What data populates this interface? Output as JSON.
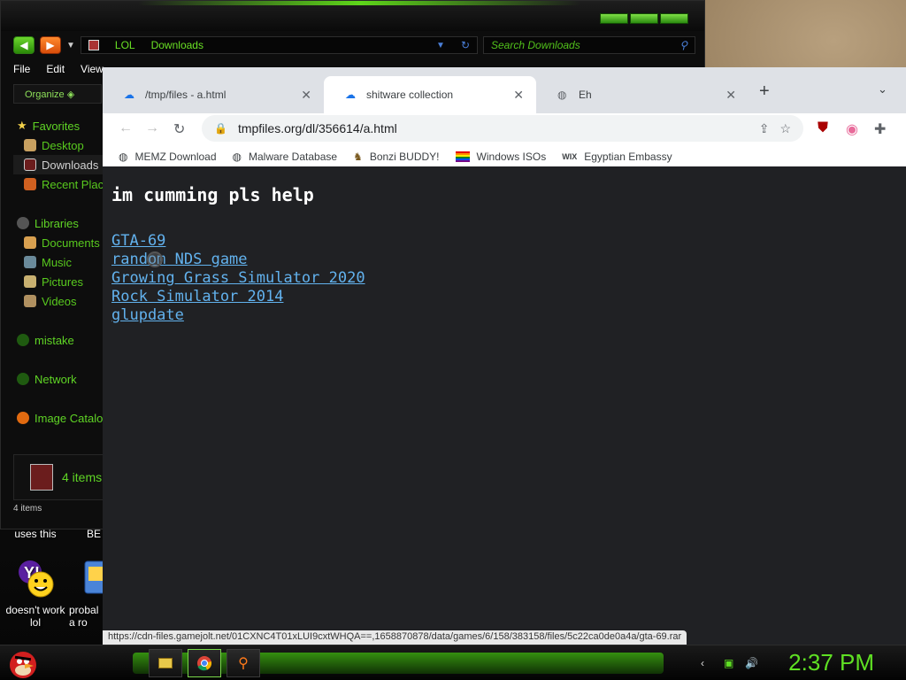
{
  "desktop": {
    "icons": [
      {
        "label": "uses this"
      },
      {
        "label": "BE"
      },
      {
        "label": "doesn't work lol"
      },
      {
        "label": "probal a ro"
      }
    ]
  },
  "explorer": {
    "address_parts": [
      "LOL",
      "Downloads"
    ],
    "search_placeholder": "Search Downloads",
    "menu": [
      "File",
      "Edit",
      "View"
    ],
    "organize_label": "Organize",
    "nav": {
      "favorites": "Favorites",
      "desktop": "Desktop",
      "downloads": "Downloads",
      "recent": "Recent Places",
      "libraries": "Libraries",
      "documents": "Documents",
      "music": "Music",
      "pictures": "Pictures",
      "videos": "Videos",
      "mistake": "mistake",
      "network": "Network",
      "image_catalog": "Image Catalog"
    },
    "item_count_detail": "4 items",
    "status": "4 items"
  },
  "chrome": {
    "tabs": [
      {
        "title": "/tmp/files - a.html"
      },
      {
        "title": "shitware collection"
      },
      {
        "title": "Eh"
      }
    ],
    "url_display": "tmpfiles.org/dl/356614/a.html",
    "bookmarks": [
      {
        "label": "MEMZ Download"
      },
      {
        "label": "Malware Database"
      },
      {
        "label": "Bonzi BUDDY!"
      },
      {
        "label": "Windows ISOs"
      },
      {
        "label": "Egyptian Embassy"
      }
    ],
    "page": {
      "heading": "im cumming pls help",
      "links": [
        "GTA-69",
        "random NDS game",
        "Growing Grass Simulator 2020",
        "Rock Simulator 2014",
        "glupdate"
      ]
    },
    "status_url": "https://cdn-files.gamejolt.net/01CXNC4T01xLUI9cxtWHQA==,1658870878/data/games/6/158/383158/files/5c22ca0de0a4a/gta-69.rar"
  },
  "taskbar": {
    "clock": "2:37 PM"
  },
  "colors": {
    "accent_green": "#5fd425",
    "link_blue": "#62b2ee",
    "page_bg": "#202124"
  }
}
